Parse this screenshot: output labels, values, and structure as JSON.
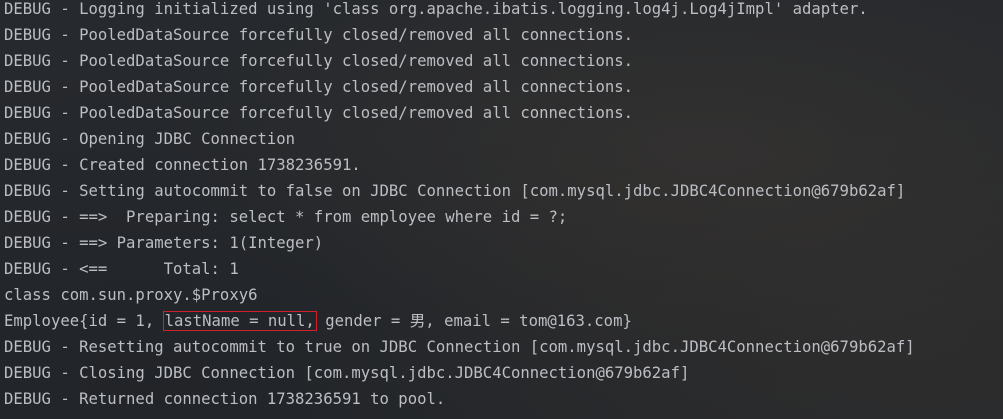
{
  "console": {
    "lines": [
      "DEBUG - Logging initialized using 'class org.apache.ibatis.logging.log4j.Log4jImpl' adapter.",
      "DEBUG - PooledDataSource forcefully closed/removed all connections.",
      "DEBUG - PooledDataSource forcefully closed/removed all connections.",
      "DEBUG - PooledDataSource forcefully closed/removed all connections.",
      "DEBUG - PooledDataSource forcefully closed/removed all connections.",
      "DEBUG - Opening JDBC Connection",
      "DEBUG - Created connection 1738236591.",
      "DEBUG - Setting autocommit to false on JDBC Connection [com.mysql.jdbc.JDBC4Connection@679b62af]",
      "DEBUG - ==>  Preparing: select * from employee where id = ?;",
      "DEBUG - ==> Parameters: 1(Integer)",
      "DEBUG - <==      Total: 1",
      "class com.sun.proxy.$Proxy6"
    ],
    "employee_line": {
      "prefix": "Employee{id = 1, ",
      "highlighted": "lastName = null,",
      "suffix": " gender = 男, email = tom@163.com}"
    },
    "tail_lines": [
      "DEBUG - Resetting autocommit to true on JDBC Connection [com.mysql.jdbc.JDBC4Connection@679b62af]",
      "DEBUG - Closing JDBC Connection [com.mysql.jdbc.JDBC4Connection@679b62af]",
      "DEBUG - Returned connection 1738236591 to pool."
    ],
    "colors": {
      "background": "#26292d",
      "text": "#bcbec4",
      "highlight_box": "#d0202a"
    }
  }
}
